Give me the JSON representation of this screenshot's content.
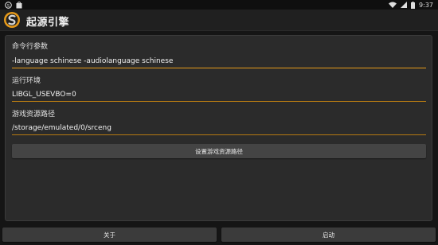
{
  "status_bar": {
    "time": "9:37",
    "left_icons": [
      "app-notification-icon",
      "store-icon"
    ],
    "right_icons": [
      "wifi-icon",
      "signal-icon",
      "battery-icon"
    ]
  },
  "app": {
    "title": "起源引擎",
    "logo_letter": "S",
    "accent_color": "#e69a1a"
  },
  "form": {
    "cmd_label": "命令行参数",
    "cmd_value": "-language schinese -audiolanguage schinese",
    "env_label": "运行环境",
    "env_value": "LIBGL_USEVBO=0",
    "path_label": "游戏资源路径",
    "path_value": "/storage/emulated/0/srceng",
    "set_path_button": "设置游戏资源路径"
  },
  "bottom": {
    "about_button": "关于",
    "launch_button": "启动"
  }
}
